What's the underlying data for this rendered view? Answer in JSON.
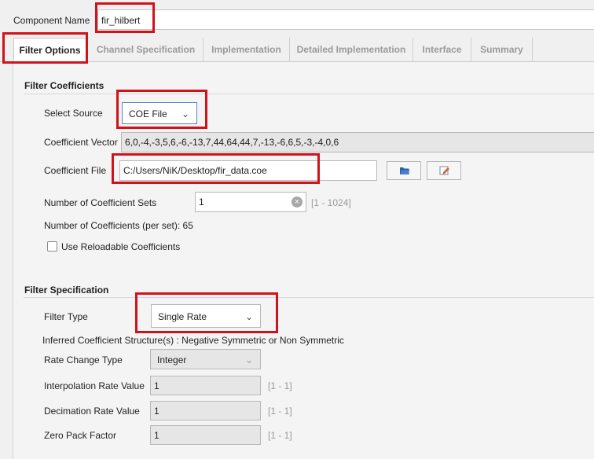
{
  "component_name": {
    "label": "Component Name",
    "value": "fir_hilbert"
  },
  "tabs": [
    {
      "label": "Filter Options",
      "active": true
    },
    {
      "label": "Channel Specification"
    },
    {
      "label": "Implementation"
    },
    {
      "label": "Detailed Implementation"
    },
    {
      "label": "Interface"
    },
    {
      "label": "Summary"
    }
  ],
  "filter_coefficients": {
    "title": "Filter Coefficients",
    "select_source": {
      "label": "Select Source",
      "value": "COE File"
    },
    "coefficient_vector": {
      "label": "Coefficient Vector",
      "value": "6,0,-4,-3,5,6,-6,-13,7,44,64,44,7,-13,-6,6,5,-3,-4,0,6"
    },
    "coefficient_file": {
      "label": "Coefficient File",
      "value": "C:/Users/NiK/Desktop/fir_data.coe"
    },
    "coefficient_sets": {
      "label": "Number of Coefficient Sets",
      "value": "1",
      "range": "[1 - 1024]"
    },
    "num_coefficients": {
      "text": "Number of Coefficients (per set): 65"
    },
    "reloadable": {
      "label": "Use Reloadable Coefficients",
      "checked": false
    }
  },
  "filter_specification": {
    "title": "Filter Specification",
    "filter_type": {
      "label": "Filter Type",
      "value": "Single Rate"
    },
    "inferred_structure": {
      "text": "Inferred Coefficient Structure(s) : Negative Symmetric or Non Symmetric"
    },
    "rate_change_type": {
      "label": "Rate Change Type",
      "value": "Integer"
    },
    "interpolation_rate": {
      "label": "Interpolation Rate Value",
      "value": "1",
      "range": "[1 - 1]"
    },
    "decimation_rate": {
      "label": "Decimation Rate Value",
      "value": "1",
      "range": "[1 - 1]"
    },
    "zero_pack": {
      "label": "Zero Pack Factor",
      "value": "1",
      "range": "[1 - 1]"
    }
  },
  "colors": {
    "highlight": "#d0121b",
    "focus": "#5a86c8"
  }
}
